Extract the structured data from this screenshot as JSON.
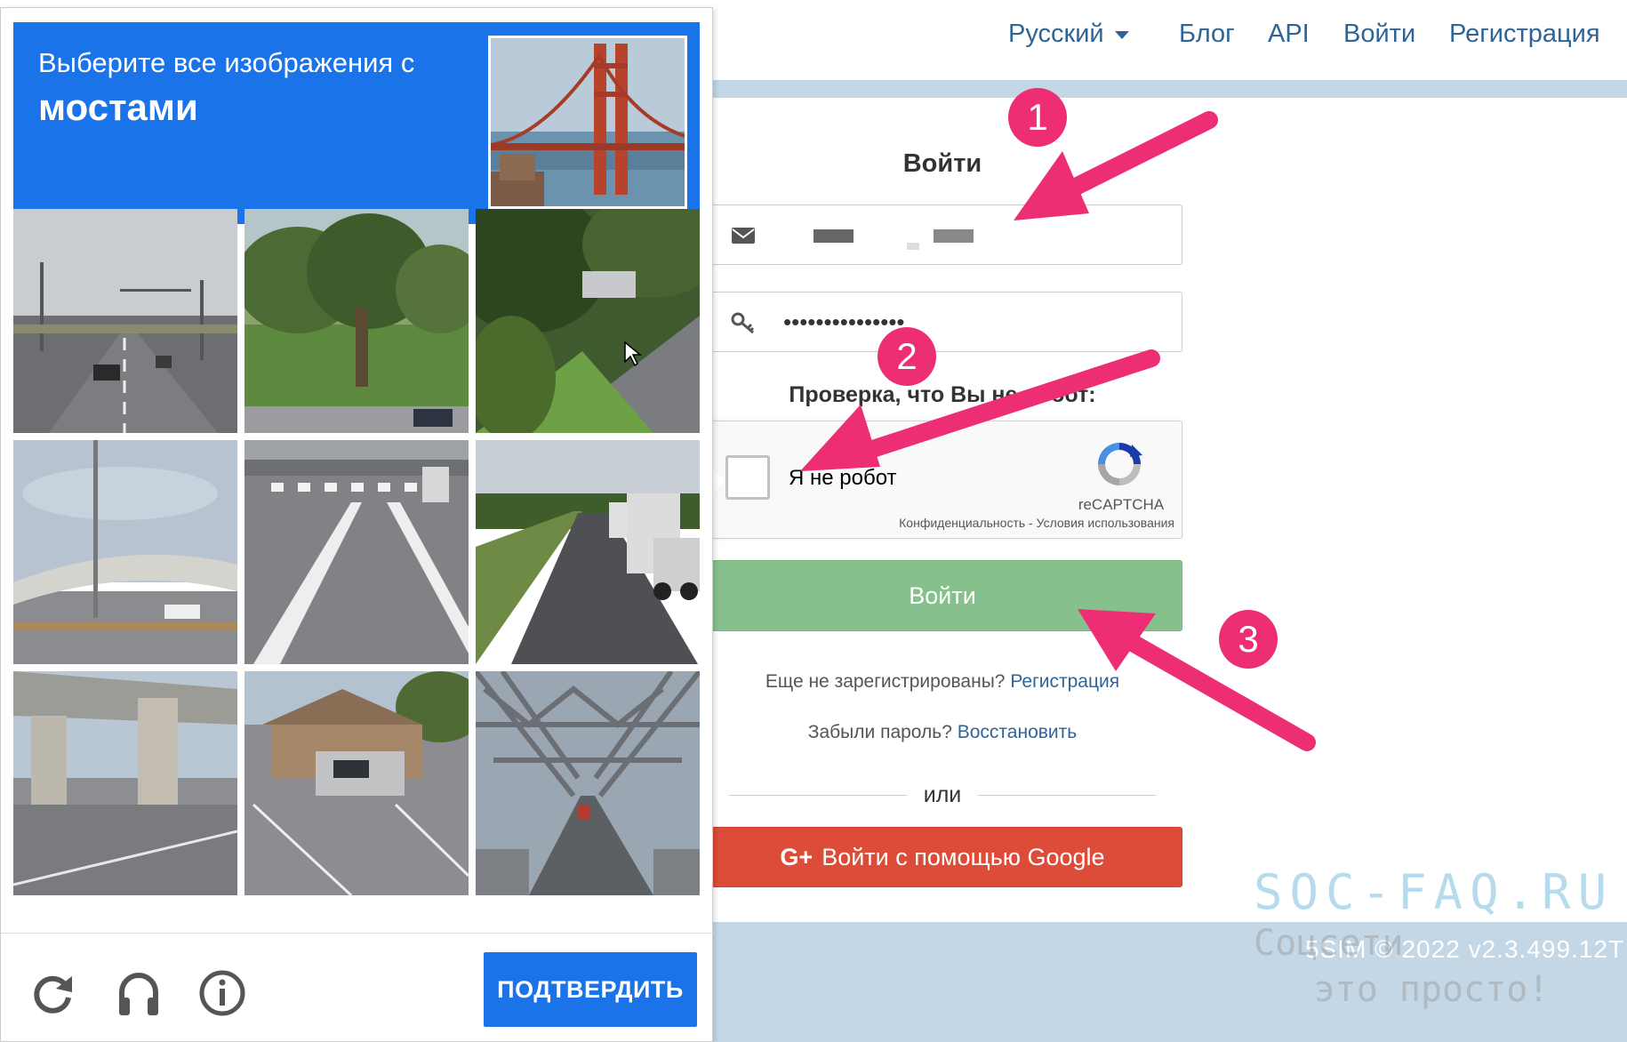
{
  "nav": {
    "language": "Русский",
    "links": [
      "Блог",
      "API",
      "Войти",
      "Регистрация"
    ]
  },
  "login": {
    "title": "Войти",
    "password_value": "•••••••••••••••",
    "verify_label": "Проверка, что Вы не робот:",
    "recaptcha": {
      "checkbox_label": "Я не робот",
      "brand": "reCAPTCHA",
      "privacy": "Конфиденциальность",
      "terms_separator": " - ",
      "terms": "Условия использования"
    },
    "submit_label": "Войти",
    "register_prompt": "Еще не зарегистрированы?",
    "register_link": "Регистрация",
    "forgot_prompt": "Забыли пароль?",
    "forgot_link": "Восстановить",
    "or_label": "или",
    "google_icon": "G+",
    "google_label": "Войти с помощью Google"
  },
  "footer": {
    "text": "5SIM © 2022 v2.3.499.12T"
  },
  "watermark": {
    "brand": "SOC-FAQ.RU",
    "line2": "Соцсети",
    "line3": "это просто!"
  },
  "captcha": {
    "instruction": "Выберите все изображения с",
    "target": "мостами",
    "tiles": [
      {
        "scene": "road-traffic-lights"
      },
      {
        "scene": "tree-lawn"
      },
      {
        "scene": "trees-parked-truck"
      },
      {
        "scene": "highway-overpass"
      },
      {
        "scene": "crosswalk-road"
      },
      {
        "scene": "highway-trucks"
      },
      {
        "scene": "underpass-pillars"
      },
      {
        "scene": "house-parking-lot"
      },
      {
        "scene": "steel-truss-bridge"
      }
    ],
    "footer_icons": [
      "reload-icon",
      "headphones-icon",
      "info-icon"
    ],
    "verify_label": "ПОДТВЕРДИТЬ"
  },
  "annotations": {
    "steps": [
      "1",
      "2",
      "3"
    ],
    "color": "#ed2e74"
  },
  "colors": {
    "link": "#2f6596",
    "captcha_blue": "#1a73e8",
    "login_button": "#86c08c",
    "google_button": "#dd4b39",
    "band": "#c3d7e6"
  }
}
